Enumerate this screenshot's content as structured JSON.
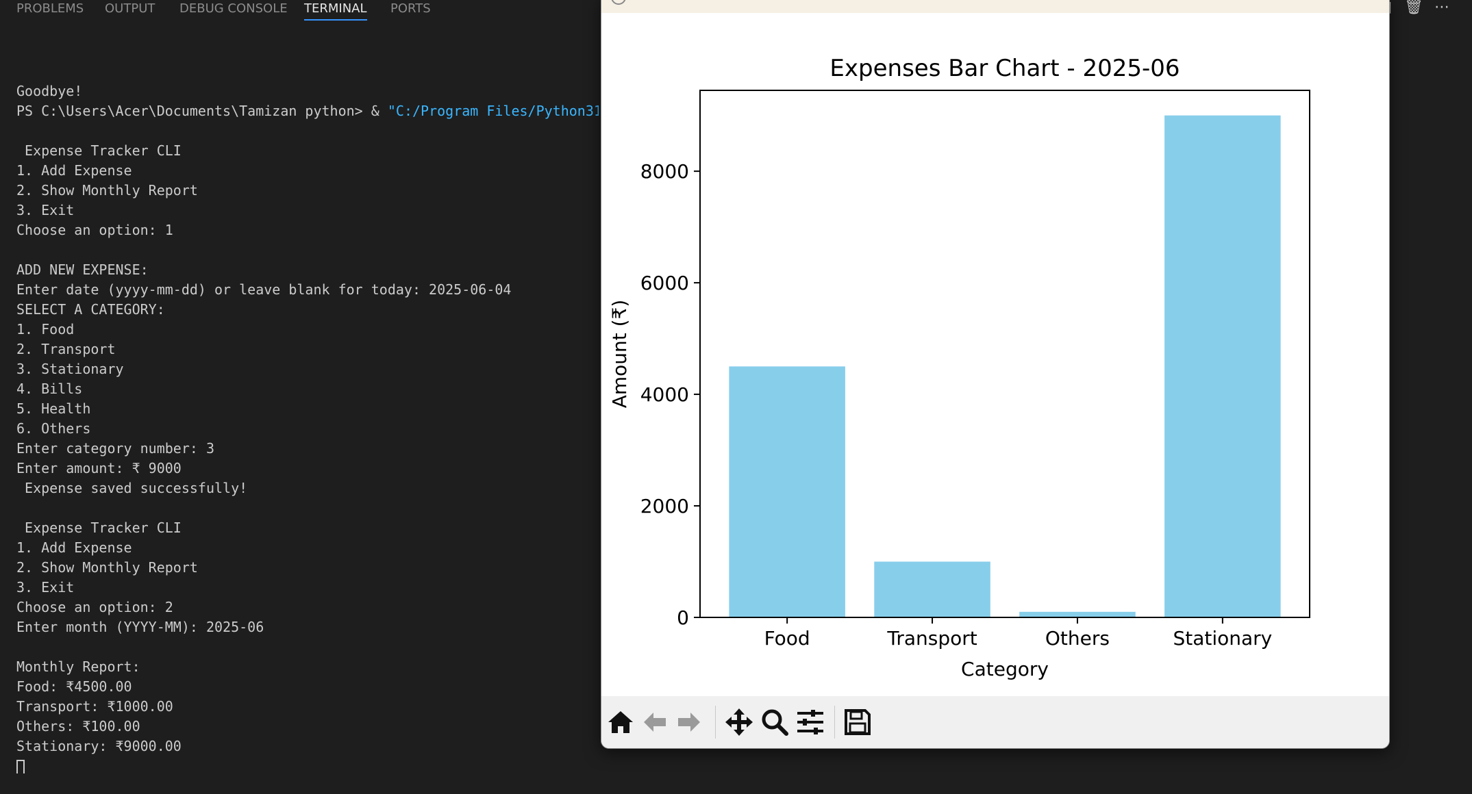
{
  "panel_tabs": [
    {
      "label": "PROBLEMS"
    },
    {
      "label": "OUTPUT"
    },
    {
      "label": "DEBUG CONSOLE"
    },
    {
      "label": "TERMINAL"
    },
    {
      "label": "PORTS"
    }
  ],
  "active_tab": "TERMINAL",
  "terminal": {
    "prompt_line": {
      "prefix": "PS C:\\Users\\Acer\\Documents\\Tamizan python> & ",
      "path": "\"C:/Program Files/Python31"
    },
    "lines": [
      "",
      "Goodbye!",
      "@PROMPT",
      "",
      " Expense Tracker CLI",
      "1. Add Expense",
      "2. Show Monthly Report",
      "3. Exit",
      "Choose an option: 1",
      "",
      "ADD NEW EXPENSE:",
      "Enter date (yyyy-mm-dd) or leave blank for today: 2025-06-04",
      "SELECT A CATEGORY:",
      "1. Food",
      "2. Transport",
      "3. Stationary",
      "4. Bills",
      "5. Health",
      "6. Others",
      "Enter category number: 3",
      "Enter amount: ₹ 9000",
      " Expense saved successfully!",
      "",
      " Expense Tracker CLI",
      "1. Add Expense",
      "2. Show Monthly Report",
      "3. Exit",
      "Choose an option: 2",
      "Enter month (YYYY-MM): 2025-06",
      "",
      "Monthly Report:",
      "Food: ₹4500.00",
      "Transport: ₹1000.00",
      "Others: ₹100.00",
      "Stationary: ₹9000.00"
    ]
  },
  "figure": {
    "toolbar": [
      {
        "name": "home-button",
        "icon": "home-icon"
      },
      {
        "name": "back-button",
        "icon": "arrow-left-icon"
      },
      {
        "name": "forward-button",
        "icon": "arrow-right-icon"
      },
      {
        "name": "pan-button",
        "icon": "move-icon"
      },
      {
        "name": "zoom-button",
        "icon": "magnifier-icon"
      },
      {
        "name": "configure-subplots-button",
        "icon": "sliders-icon"
      },
      {
        "name": "save-button",
        "icon": "floppy-disk-icon"
      }
    ]
  },
  "chart_data": {
    "type": "bar",
    "title": "Expenses Bar Chart - 2025-06",
    "xlabel": "Category",
    "ylabel": "Amount (₹)",
    "categories": [
      "Food",
      "Transport",
      "Others",
      "Stationary"
    ],
    "values": [
      4500,
      1000,
      100,
      9000
    ],
    "ylim": [
      0,
      9450
    ],
    "yticks": [
      0,
      2000,
      4000,
      6000,
      8000
    ],
    "bar_color": "#87ceeb",
    "grid": false
  },
  "colors": {
    "terminal_bg": "#1e1e1e",
    "terminal_text": "#cccccc",
    "path_color": "#3ab6ff",
    "tab_active_underline": "#3794ff"
  }
}
